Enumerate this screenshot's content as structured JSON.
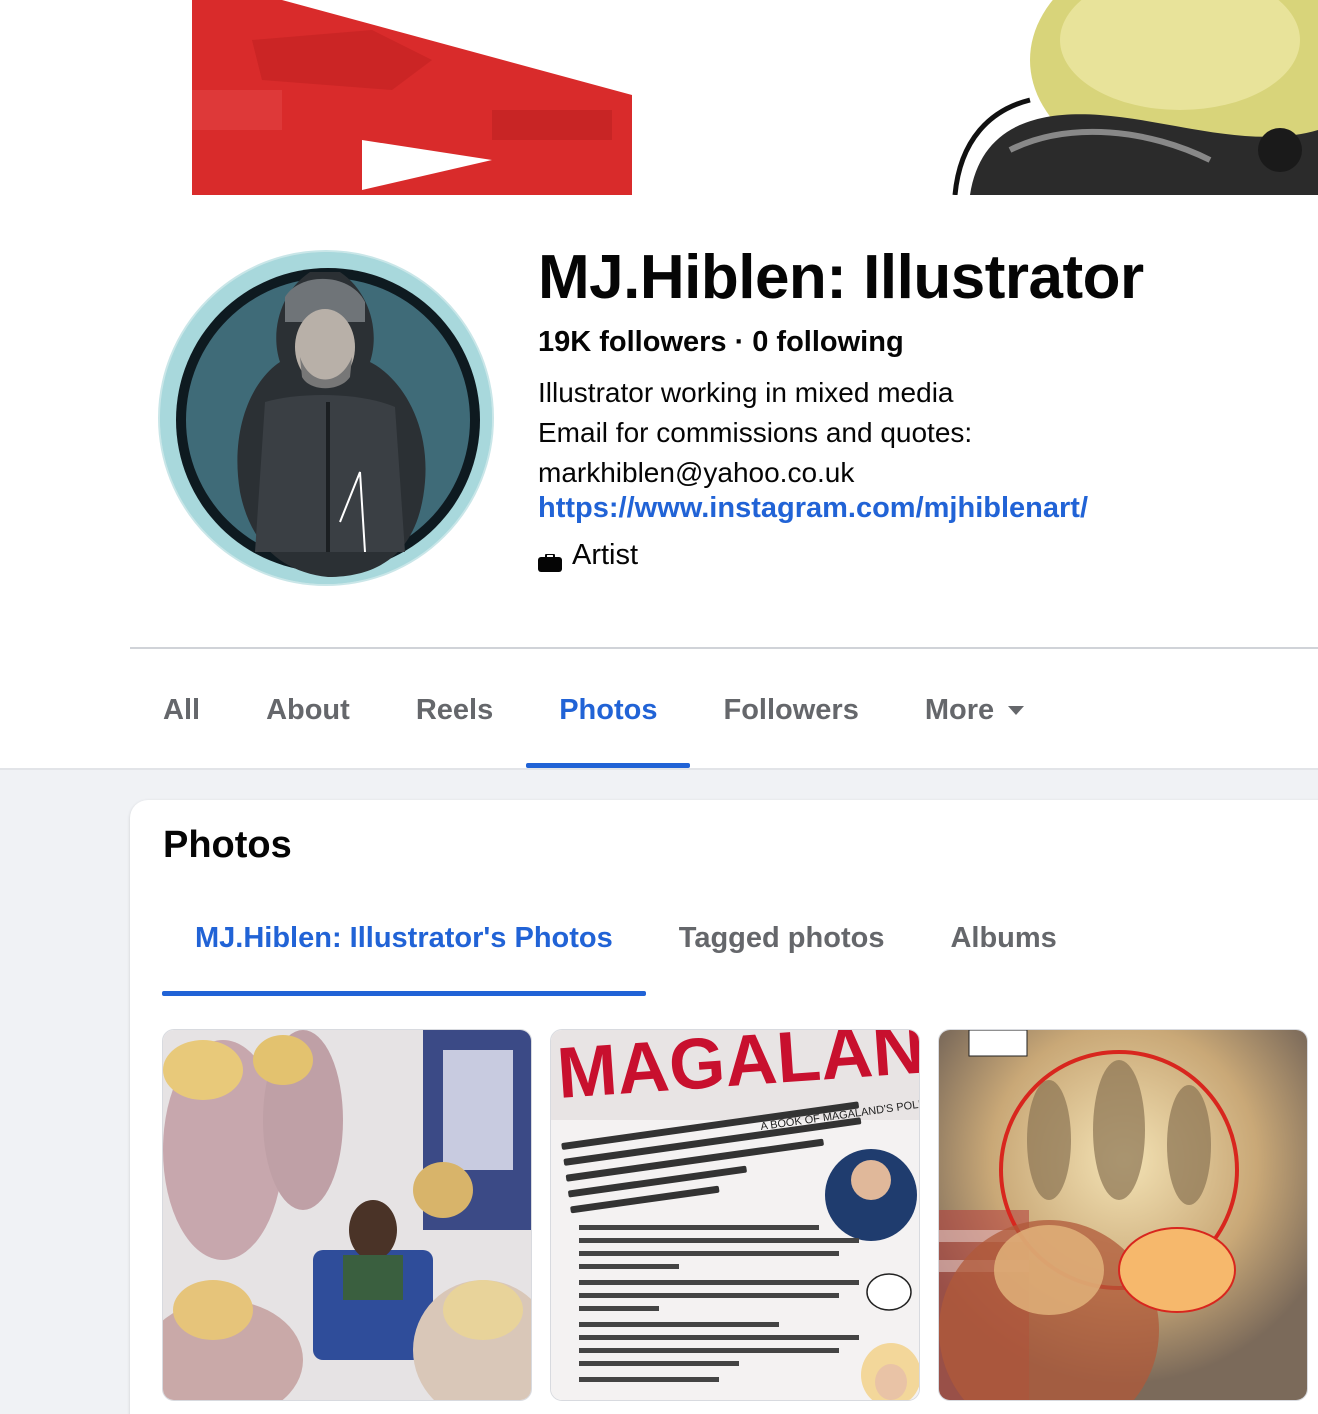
{
  "profile": {
    "name": "MJ.Hiblen: Illustrator",
    "followers": "19K followers",
    "separator": "·",
    "following": "0 following",
    "bio_lines": [
      "Illustrator working in mixed media",
      "Email for commissions and quotes:",
      "markhiblen@yahoo.co.uk"
    ],
    "link": "https://www.instagram.com/mjhiblenart/",
    "category": "Artist",
    "category_icon": "briefcase-icon"
  },
  "tabs": [
    {
      "label": "All"
    },
    {
      "label": "About"
    },
    {
      "label": "Reels"
    },
    {
      "label": "Photos",
      "active": true
    },
    {
      "label": "Followers"
    },
    {
      "label": "More",
      "icon": "caret-down-icon"
    }
  ],
  "photos_section": {
    "title": "Photos",
    "subtabs": [
      {
        "label": "MJ.Hiblen: Illustrator's Photos",
        "active": true
      },
      {
        "label": "Tagged photos"
      },
      {
        "label": "Albums"
      }
    ]
  },
  "thumbnails": [
    {
      "name": "photo-thumbnail-bus-illustration"
    },
    {
      "name": "photo-thumbnail-magaland-poster",
      "title": "MAGALAND",
      "subtitle": "A BOOK OF MAGALAND'S POLITICAL ART"
    },
    {
      "name": "photo-thumbnail-angels-illustration"
    }
  ],
  "colors": {
    "accent": "#2163d6",
    "text_primary": "#050505",
    "text_secondary": "#65676b",
    "background": "#f0f2f5",
    "cover_red": "#d92b2b",
    "avatar_bg": "#a8d8dc"
  }
}
